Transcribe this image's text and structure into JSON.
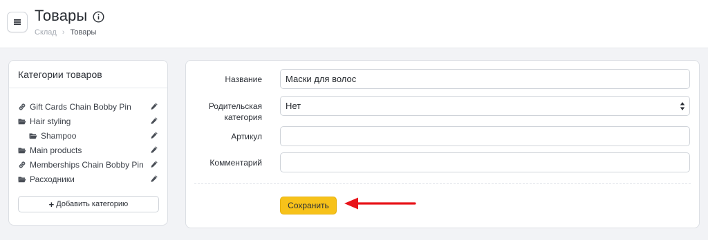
{
  "header": {
    "title": "Товары",
    "breadcrumb": {
      "root": "Склад",
      "current": "Товары"
    },
    "icons": {
      "menu": "hamburger-icon",
      "info": "info-icon"
    }
  },
  "categories": {
    "title": "Категории товаров",
    "items": [
      {
        "label": "Gift Cards Chain Bobby Pin",
        "icon": "link-icon",
        "indent": false
      },
      {
        "label": "Hair styling",
        "icon": "folder-open-icon",
        "indent": false
      },
      {
        "label": "Shampoo",
        "icon": "folder-open-icon",
        "indent": true
      },
      {
        "label": "Main products",
        "icon": "folder-open-icon",
        "indent": false
      },
      {
        "label": "Memberships Chain Bobby Pin",
        "icon": "link-icon",
        "indent": false
      },
      {
        "label": "Расходники",
        "icon": "folder-open-icon",
        "indent": false
      }
    ],
    "add_button": "Добавить категорию"
  },
  "form": {
    "name_label": "Название",
    "name_value": "Маски для волос",
    "parent_label_line1": "Родительская",
    "parent_label_line2": "категория",
    "parent_value": "Нет",
    "sku_label": "Артикул",
    "sku_value": "",
    "comment_label": "Комментарий",
    "comment_value": "",
    "save_button": "Сохранить"
  },
  "colors": {
    "accent": "#f7c21a",
    "annotation_arrow": "#e8141a",
    "page_bg": "#f2f3f6"
  }
}
